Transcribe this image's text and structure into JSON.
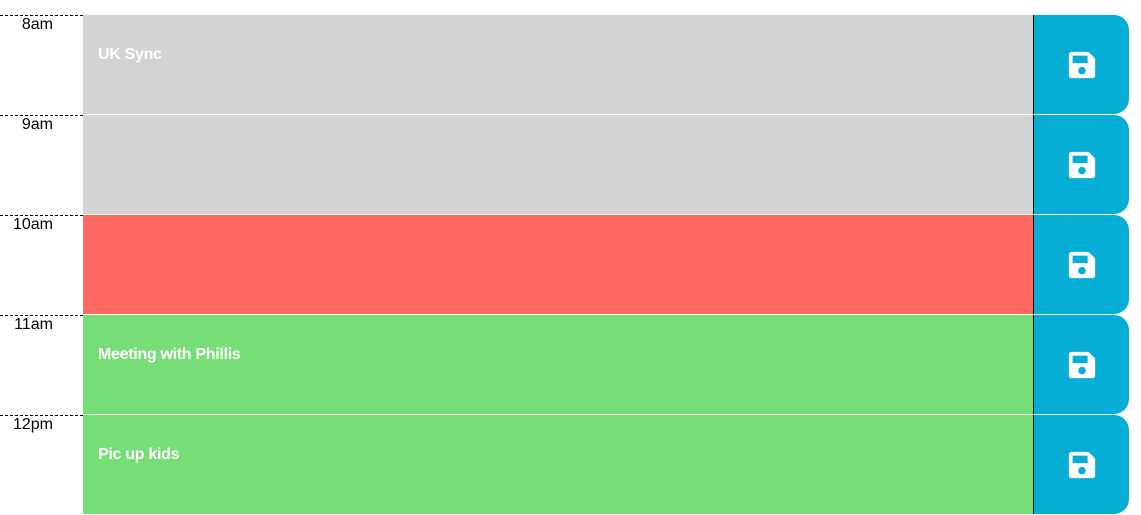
{
  "colors": {
    "past": "#d3d3d3",
    "present": "#ff6961",
    "future": "#77dd77",
    "save": "#06aed5"
  },
  "rows": [
    {
      "hour": "8am",
      "text": "UK Sync",
      "status": "past",
      "save_icon": "floppy-disk-icon"
    },
    {
      "hour": "9am",
      "text": "",
      "status": "past",
      "save_icon": "floppy-disk-icon"
    },
    {
      "hour": "10am",
      "text": "",
      "status": "present",
      "save_icon": "floppy-disk-icon"
    },
    {
      "hour": "11am",
      "text": "Meeting with Phillis",
      "status": "future",
      "save_icon": "floppy-disk-icon"
    },
    {
      "hour": "12pm",
      "text": "Pic up kids",
      "status": "future",
      "save_icon": "floppy-disk-icon"
    }
  ]
}
